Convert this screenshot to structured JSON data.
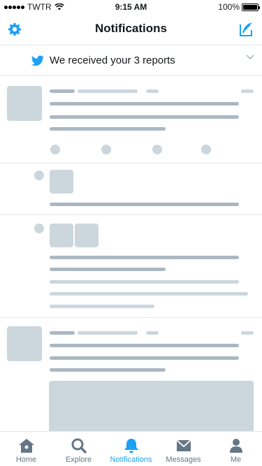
{
  "status_bar": {
    "carrier": "TWTR",
    "time": "9:15 AM",
    "battery": "100%",
    "battery_level": 1.0
  },
  "nav": {
    "title": "Notifications",
    "left_icon": "gear-icon",
    "right_icon": "compose-icon"
  },
  "banner": {
    "icon": "twitter-bird-icon",
    "text": "We received your 3 reports",
    "chevron": "chevron-down-icon"
  },
  "tabs": [
    {
      "label": "Home",
      "icon": "home-icon",
      "active": false
    },
    {
      "label": "Explore",
      "icon": "search-icon",
      "active": false
    },
    {
      "label": "Notifications",
      "icon": "bell-icon",
      "active": true
    },
    {
      "label": "Messages",
      "icon": "envelope-icon",
      "active": false
    },
    {
      "label": "Me",
      "icon": "person-icon",
      "active": false
    }
  ],
  "colors": {
    "accent": "#1da1f2",
    "inactive": "#657786",
    "skeleton_dark": "#aab8c2",
    "skeleton_light": "#ccd6dd",
    "divider": "#e1e8ed"
  }
}
